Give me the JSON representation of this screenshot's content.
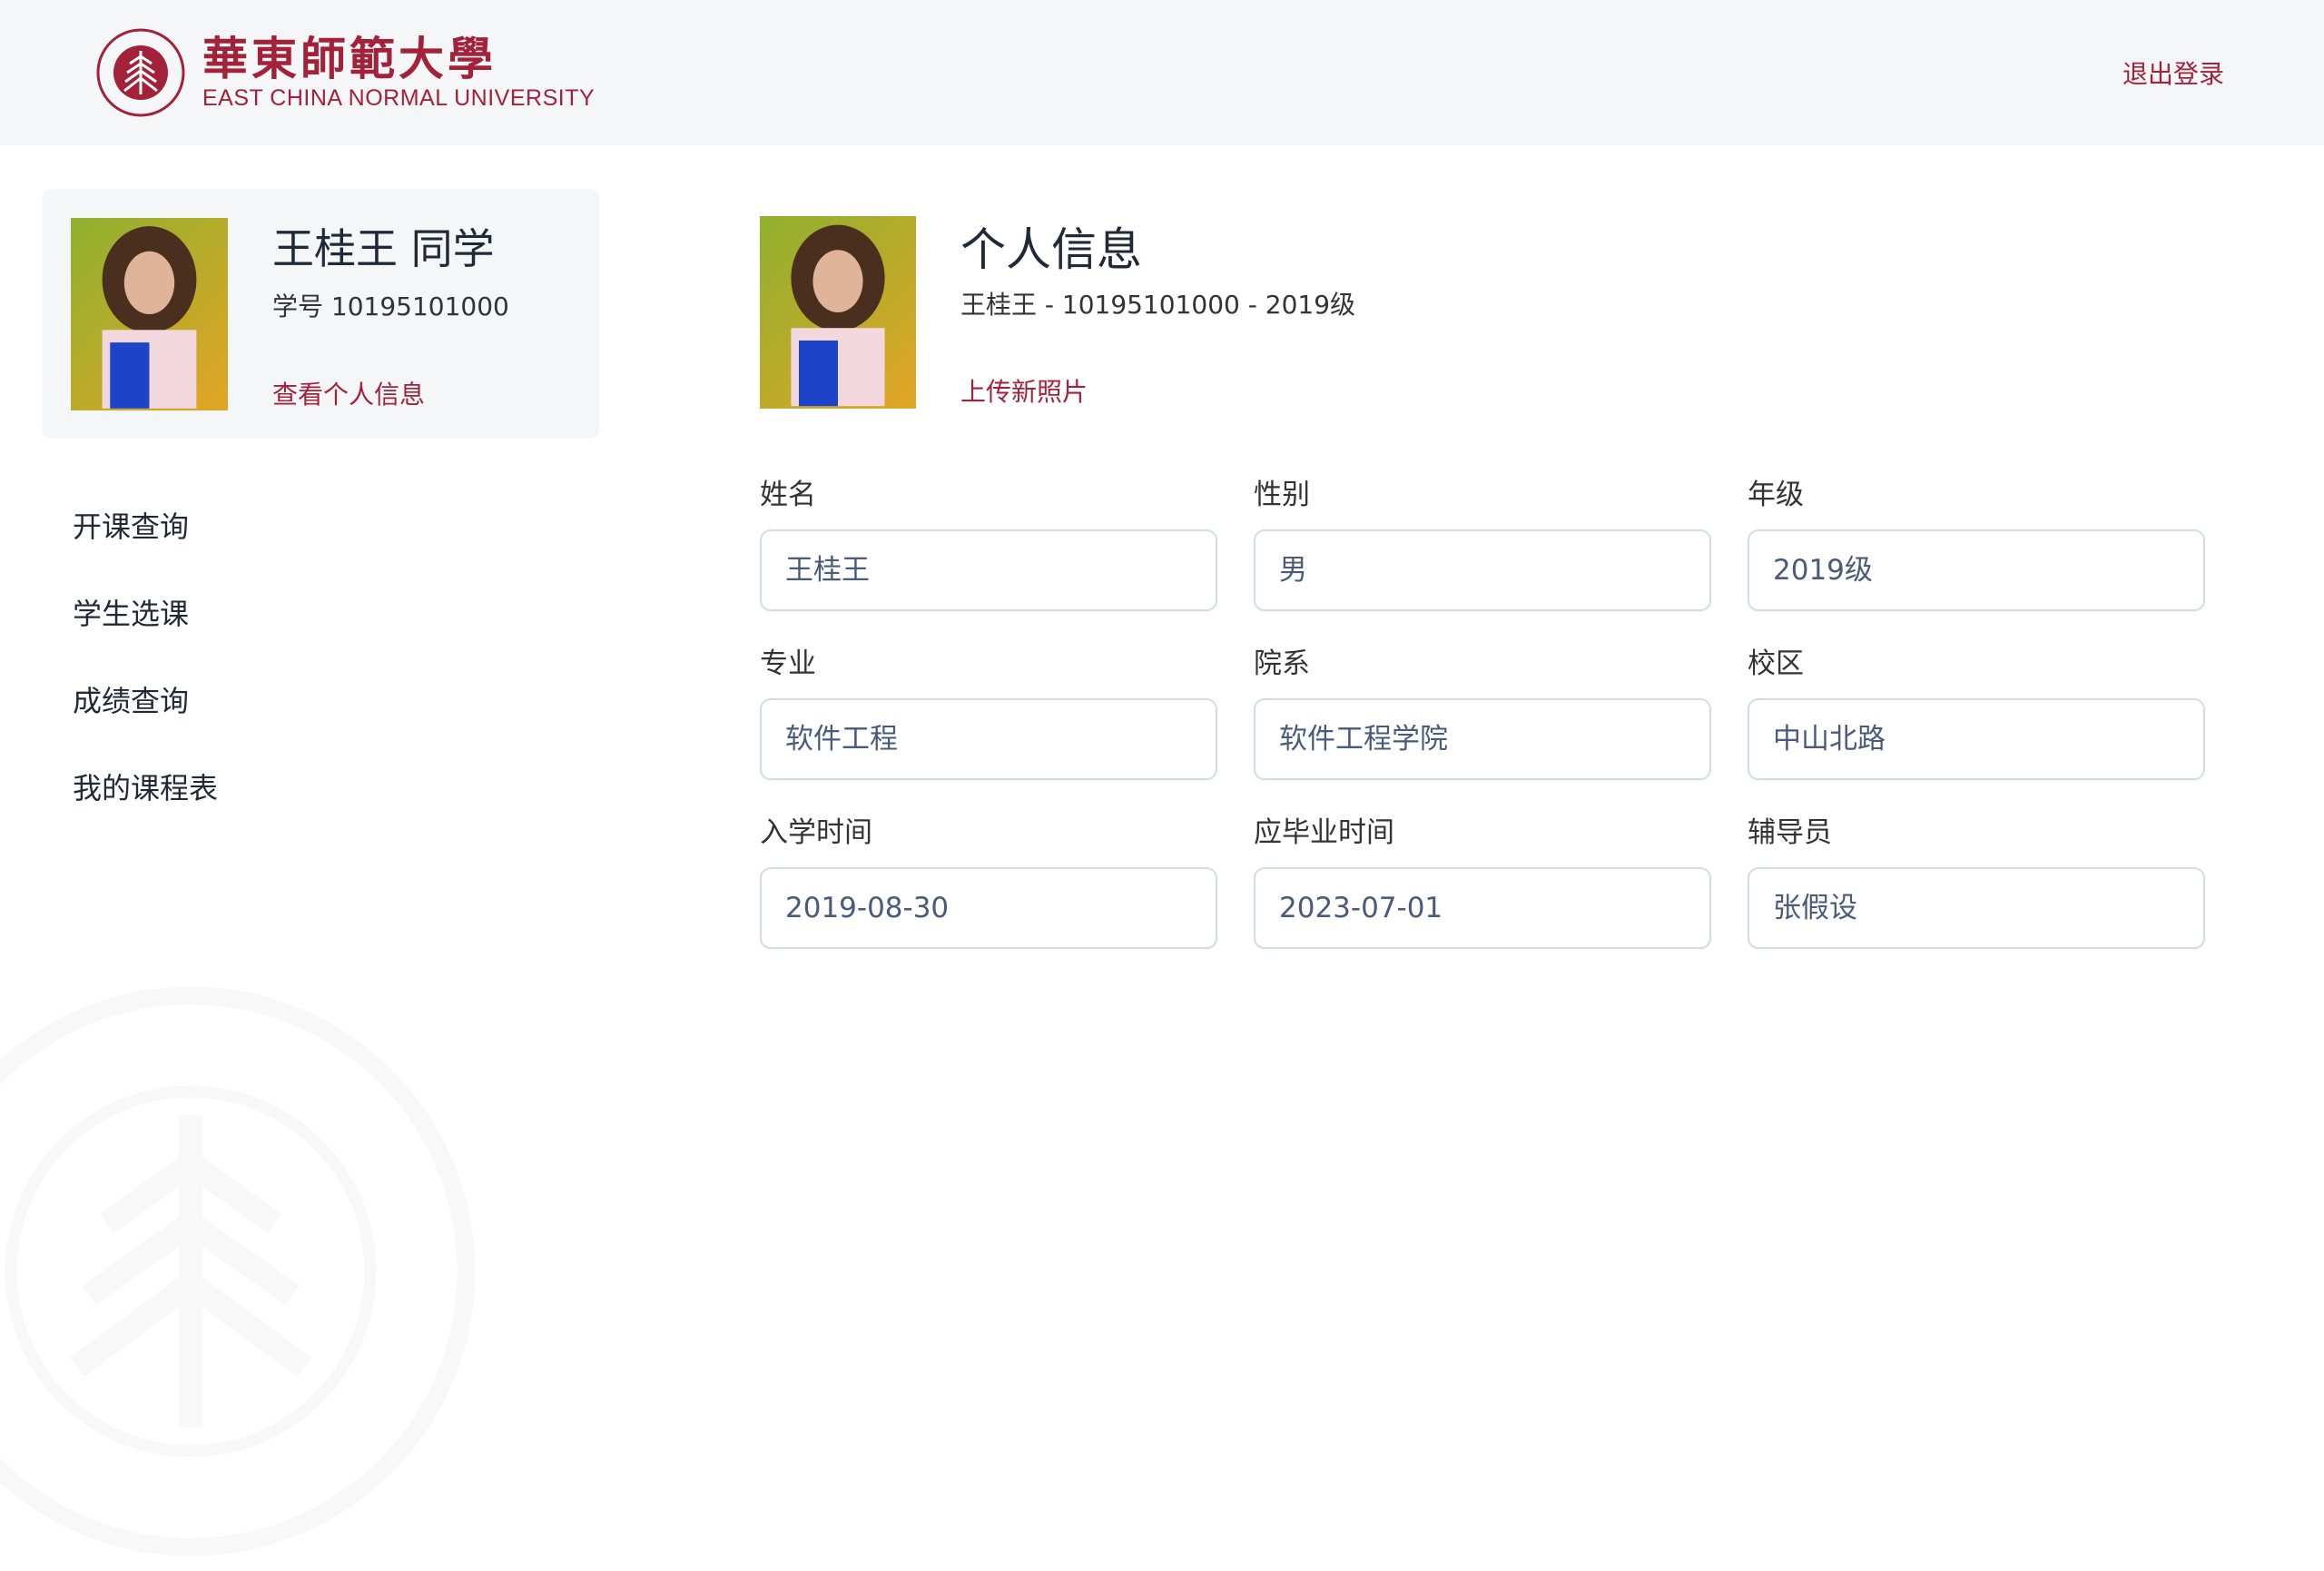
{
  "header": {
    "logo_cn": "華東師範大學",
    "logo_en": "EAST CHINA NORMAL UNIVERSITY",
    "logout": "退出登录"
  },
  "colors": {
    "brand": "#a3223a",
    "header_bg": "#f5f6f8"
  },
  "profile_card": {
    "name": "王桂王 同学",
    "student_id": "学号 10195101000",
    "view_link": "查看个人信息"
  },
  "menu": [
    {
      "label": "开课查询"
    },
    {
      "label": "学生选课"
    },
    {
      "label": "成绩查询"
    },
    {
      "label": "我的课程表"
    }
  ],
  "main": {
    "title": "个人信息",
    "subtitle": "王桂王 - 10195101000 - 2019级",
    "upload": "上传新照片",
    "fields": [
      {
        "label": "姓名",
        "value": "王桂王"
      },
      {
        "label": "性别",
        "value": "男"
      },
      {
        "label": "年级",
        "value": "2019级"
      },
      {
        "label": "专业",
        "value": "软件工程"
      },
      {
        "label": "院系",
        "value": "软件工程学院"
      },
      {
        "label": "校区",
        "value": "中山北路"
      },
      {
        "label": "入学时间",
        "value": "2019-08-30"
      },
      {
        "label": "应毕业时间",
        "value": "2023-07-01"
      },
      {
        "label": "辅导员",
        "value": "张假设"
      }
    ]
  }
}
